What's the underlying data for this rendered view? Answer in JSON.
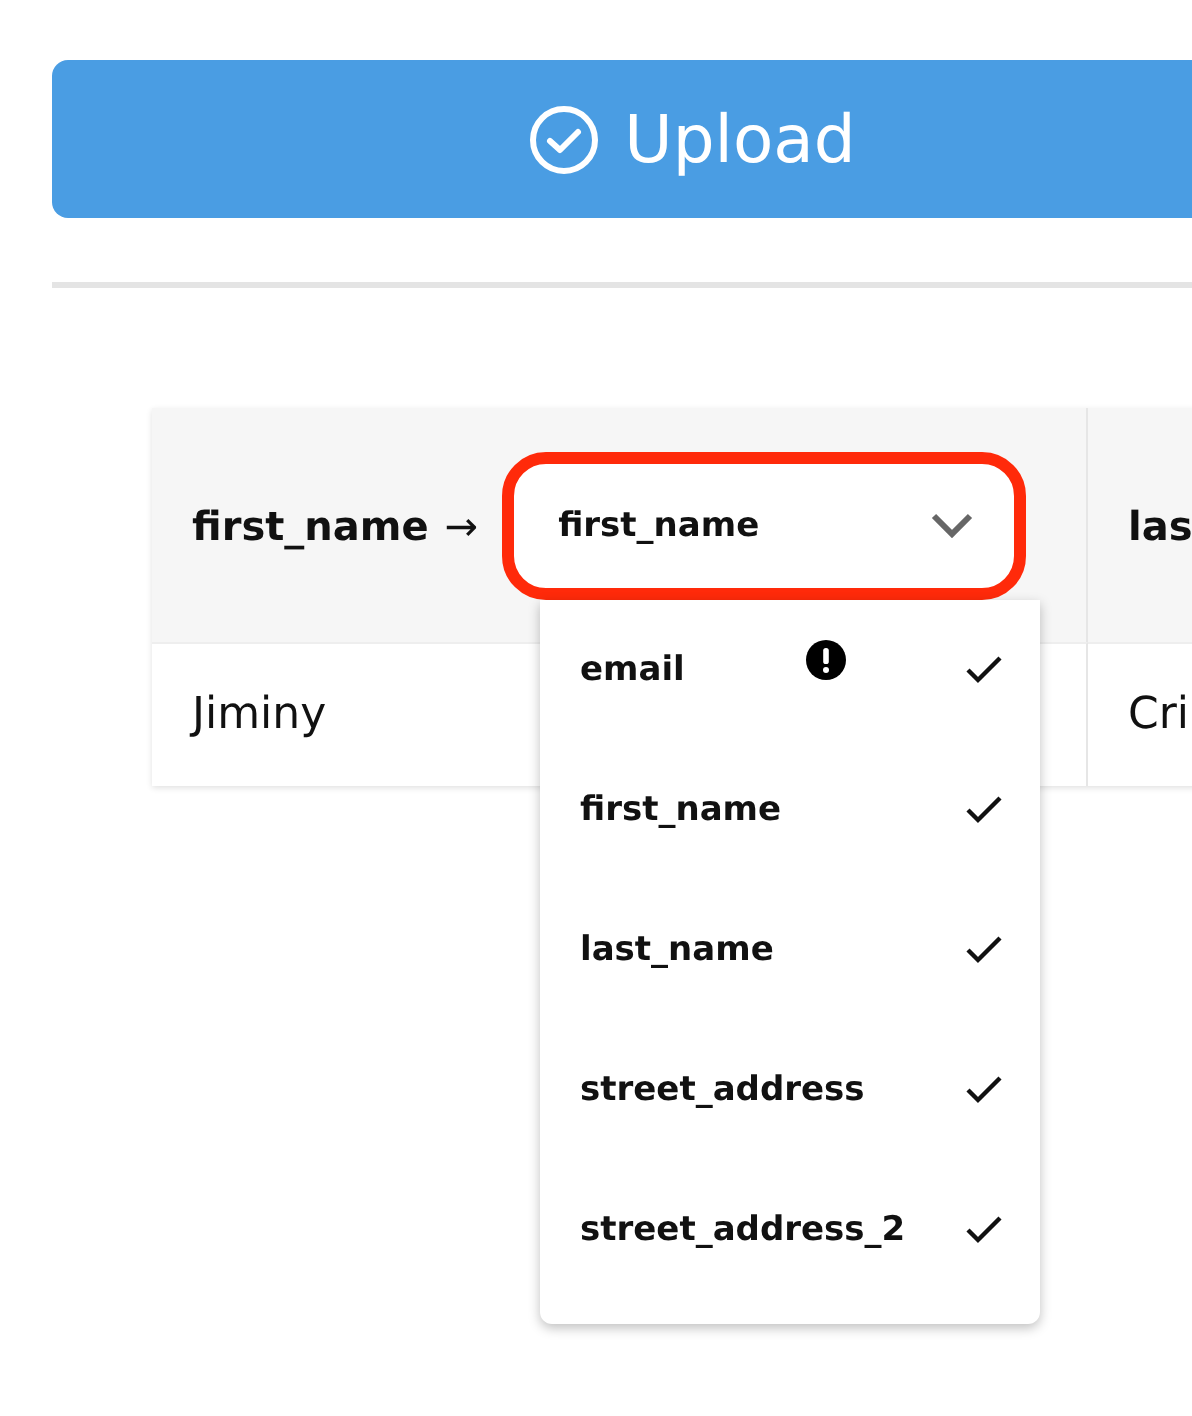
{
  "upload_button": {
    "label": "Upload"
  },
  "table": {
    "columns": [
      {
        "source": "first_name",
        "arrow": "→",
        "select": {
          "value": "first_name",
          "highlighted": true,
          "expanded": true
        }
      },
      {
        "source": "las"
      }
    ],
    "rows": [
      {
        "cells": [
          "Jiminy",
          "Cri"
        ]
      }
    ]
  },
  "dropdown_options": [
    {
      "label": "email",
      "warning": true,
      "checked": true
    },
    {
      "label": "first_name",
      "warning": false,
      "checked": true
    },
    {
      "label": "last_name",
      "warning": false,
      "checked": true
    },
    {
      "label": "street_address",
      "warning": false,
      "checked": true
    },
    {
      "label": "street_address_2",
      "warning": false,
      "checked": true
    }
  ]
}
